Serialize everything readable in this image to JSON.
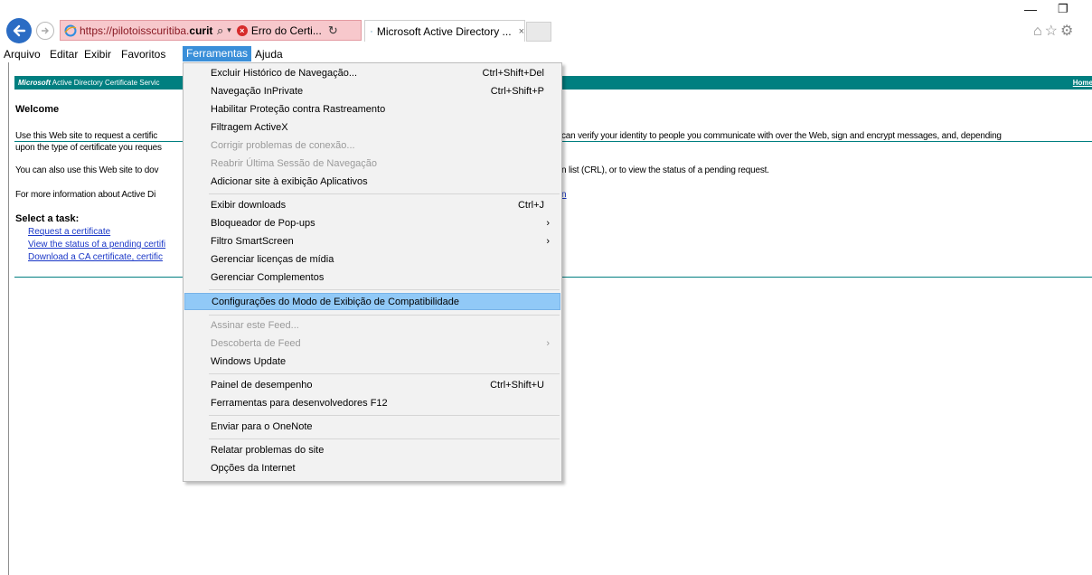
{
  "browser": {
    "address": {
      "url_prefix": "https://pilotoisscuritiba.",
      "url_domain": "curitiba.p..",
      "search_glyph": "⌕",
      "cert_error": "Erro do Certi...",
      "refresh_glyph": "↻"
    },
    "tab": {
      "title": "Microsoft Active Directory ...",
      "close": "×"
    },
    "window": {
      "minimize": "—",
      "restore": "❐"
    },
    "right_icons": "⌂☆⚙"
  },
  "menubar": {
    "items": [
      "Arquivo",
      "Editar",
      "Exibir",
      "Favoritos",
      "Ferramentas",
      "Ajuda"
    ],
    "active": "Ferramentas"
  },
  "page": {
    "banner": {
      "title_bold": "Microsoft",
      "title_rest": " Active Directory Certificate Servic",
      "home": "Home"
    },
    "welcome": "Welcome",
    "p1_left_1": "Use this Web site to request a certific",
    "p1_left_2": "upon the type of certificate you reques",
    "p1_right": "can verify your identity to people you communicate with over the Web, sign and encrypt messages, and, depending",
    "p2_left": "You can also use this Web site to dov",
    "p2_right": "n list (CRL), or to view the status of a pending request.",
    "p3_left": "For more information about Active Di",
    "p3_link": "n",
    "select_task": "Select a task:",
    "tasks": [
      "Request a certificate",
      "View the status of a pending certifi",
      "Download a CA certificate, certific"
    ]
  },
  "dropdown": {
    "items": [
      {
        "label": "Excluir Histórico de Navegação...",
        "shortcut": "Ctrl+Shift+Del"
      },
      {
        "label": "Navegação InPrivate",
        "shortcut": "Ctrl+Shift+P"
      },
      {
        "label": "Habilitar Proteção contra Rastreamento",
        "shortcut": ""
      },
      {
        "label": "Filtragem ActiveX",
        "shortcut": ""
      },
      {
        "label": "Corrigir problemas de conexão...",
        "shortcut": ""
      },
      {
        "label": "Reabrir Última Sessão de Navegação",
        "shortcut": ""
      },
      {
        "label": "Adicionar site à exibição Aplicativos",
        "shortcut": ""
      },
      {
        "label": "Exibir downloads",
        "shortcut": "Ctrl+J"
      },
      {
        "label": "Bloqueador de Pop-ups",
        "shortcut": ""
      },
      {
        "label": "Filtro SmartScreen",
        "shortcut": ""
      },
      {
        "label": "Gerenciar licenças de mídia",
        "shortcut": ""
      },
      {
        "label": "Gerenciar Complementos",
        "shortcut": ""
      },
      {
        "label": "Configurações do Modo de Exibição de Compatibilidade",
        "shortcut": ""
      },
      {
        "label": "Assinar este Feed...",
        "shortcut": ""
      },
      {
        "label": "Descoberta de Feed",
        "shortcut": ""
      },
      {
        "label": "Windows Update",
        "shortcut": ""
      },
      {
        "label": "Painel de desempenho",
        "shortcut": "Ctrl+Shift+U"
      },
      {
        "label": "Ferramentas para desenvolvedores F12",
        "shortcut": ""
      },
      {
        "label": "Enviar para o OneNote",
        "shortcut": ""
      },
      {
        "label": "Relatar problemas do site",
        "shortcut": ""
      },
      {
        "label": "Opções da Internet",
        "shortcut": ""
      }
    ],
    "submenu_arrow": "›"
  },
  "colors": {
    "accent": "#3a8fd9",
    "highlight": "#91c9f7",
    "banner": "#007f80",
    "link": "#1a37c7",
    "cert_error_bg": "#f7c8cc"
  },
  "icons": [
    "back-arrow-icon",
    "forward-arrow-icon",
    "ie-logo-icon",
    "search-icon",
    "cert-error-icon",
    "refresh-icon",
    "close-icon",
    "home-icon",
    "favorites-star-icon",
    "settings-gear-icon"
  ]
}
